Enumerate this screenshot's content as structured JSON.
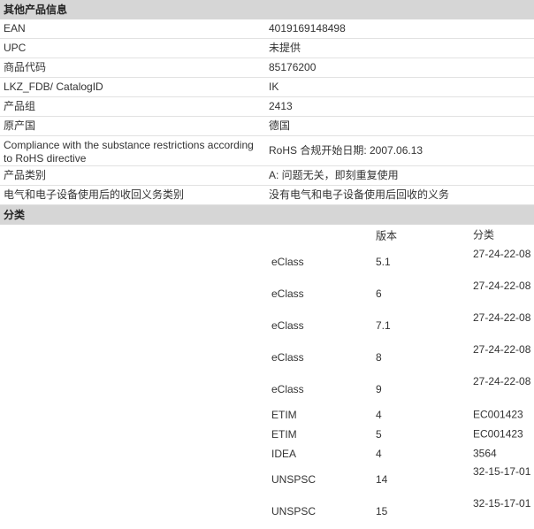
{
  "other_info": {
    "title": "其他产品信息",
    "rows": [
      {
        "label": "EAN",
        "value": "4019169148498"
      },
      {
        "label": "UPC",
        "value": "未提供"
      },
      {
        "label": "商品代码",
        "value": "85176200"
      },
      {
        "label": "LKZ_FDB/ CatalogID",
        "value": "IK"
      },
      {
        "label": "产品组",
        "value": "2413"
      },
      {
        "label": "原产国",
        "value": "德国"
      },
      {
        "label": "Compliance with the substance restrictions according to RoHS directive",
        "value": "RoHS 合规开始日期: 2007.06.13"
      },
      {
        "label": "产品类别",
        "value": "A: 问题无关，即刻重复使用"
      },
      {
        "label": "电气和电子设备使用后的收回义务类别",
        "value": "没有电气和电子设备使用后回收的义务"
      }
    ]
  },
  "classification": {
    "title": "分类",
    "col_version": "版本",
    "col_class": "分类",
    "rows": [
      {
        "system": "eClass",
        "version": "5.1",
        "code": "27-24-22-08"
      },
      {
        "system": "eClass",
        "version": "6",
        "code": "27-24-22-08"
      },
      {
        "system": "eClass",
        "version": "7.1",
        "code": "27-24-22-08"
      },
      {
        "system": "eClass",
        "version": "8",
        "code": "27-24-22-08"
      },
      {
        "system": "eClass",
        "version": "9",
        "code": "27-24-22-08"
      },
      {
        "system": "ETIM",
        "version": "4",
        "code": "EC001423"
      },
      {
        "system": "ETIM",
        "version": "5",
        "code": "EC001423"
      },
      {
        "system": "IDEA",
        "version": "4",
        "code": "3564"
      },
      {
        "system": "UNSPSC",
        "version": "14",
        "code": "32-15-17-01"
      },
      {
        "system": "UNSPSC",
        "version": "15",
        "code": "32-15-17-01"
      }
    ]
  }
}
